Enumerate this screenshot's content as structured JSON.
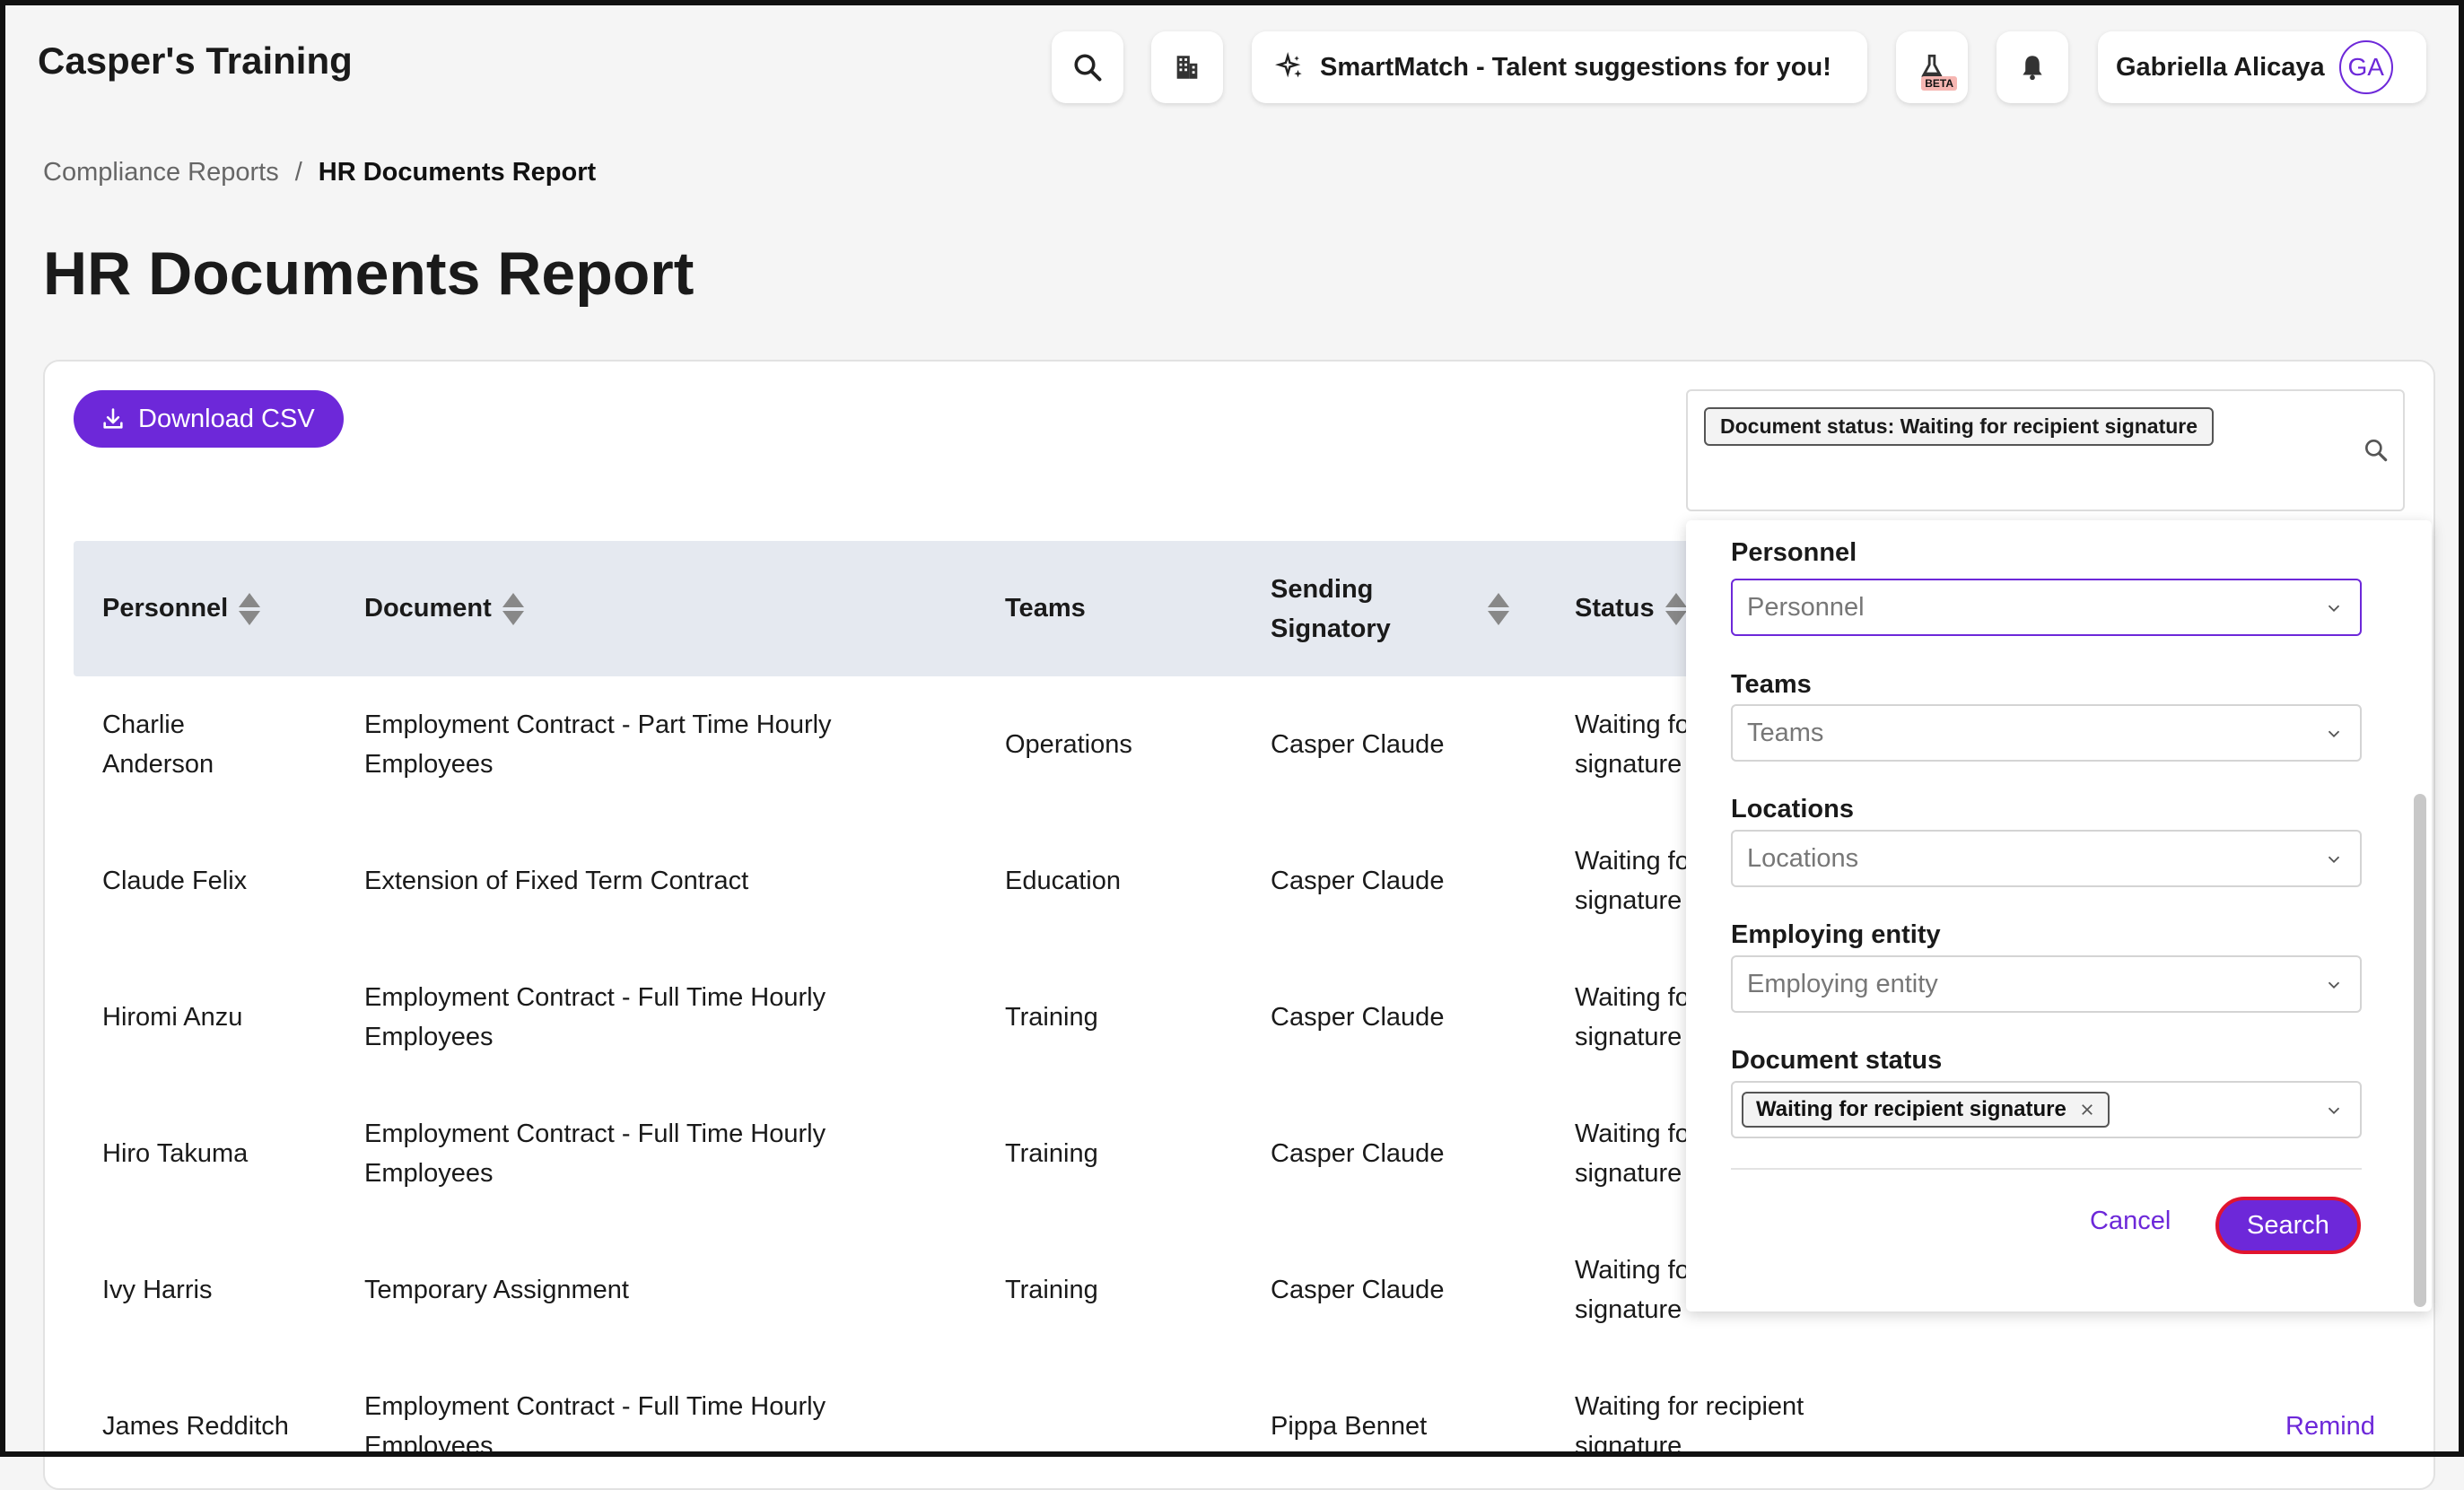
{
  "app": {
    "title": "Casper's Training"
  },
  "header": {
    "smartmatch_label": "SmartMatch - Talent suggestions for you!",
    "beta_label": "BETA",
    "user_name": "Gabriella Alicaya",
    "user_initials": "GA"
  },
  "breadcrumb": {
    "parent": "Compliance Reports",
    "separator": "/",
    "current": "HR Documents Report"
  },
  "page": {
    "title": "HR Documents Report"
  },
  "toolbar": {
    "download_label": "Download CSV"
  },
  "filter": {
    "chip_label": "Document status: Waiting for recipient signature"
  },
  "table": {
    "columns": {
      "personnel": "Personnel",
      "document": "Document",
      "teams": "Teams",
      "signatory": [
        "Sending",
        "Signatory"
      ],
      "status": "Status"
    },
    "rows": [
      {
        "personnel": [
          "Charlie",
          "Anderson"
        ],
        "document": [
          "Employment Contract - Part Time Hourly",
          "Employees"
        ],
        "teams": "Operations",
        "signatory": "Casper Claude",
        "status": [
          "Waiting for recipient",
          "signature"
        ],
        "action": ""
      },
      {
        "personnel": [
          "Claude Felix"
        ],
        "document": [
          "Extension of Fixed Term Contract"
        ],
        "teams": "Education",
        "signatory": "Casper Claude",
        "status": [
          "Waiting for recipient",
          "signature"
        ],
        "action": ""
      },
      {
        "personnel": [
          "Hiromi Anzu"
        ],
        "document": [
          "Employment Contract - Full Time Hourly",
          "Employees"
        ],
        "teams": "Training",
        "signatory": "Casper Claude",
        "status": [
          "Waiting for recipient",
          "signature"
        ],
        "action": ""
      },
      {
        "personnel": [
          "Hiro Takuma"
        ],
        "document": [
          "Employment Contract - Full Time Hourly",
          "Employees"
        ],
        "teams": "Training",
        "signatory": "Casper Claude",
        "status": [
          "Waiting for recipient",
          "signature"
        ],
        "action": ""
      },
      {
        "personnel": [
          "Ivy Harris"
        ],
        "document": [
          "Temporary Assignment"
        ],
        "teams": "Training",
        "signatory": "Casper Claude",
        "status": [
          "Waiting for recipient",
          "signature"
        ],
        "action": ""
      },
      {
        "personnel": [
          "James Redditch"
        ],
        "document": [
          "Employment Contract - Full Time Hourly",
          "Employees"
        ],
        "teams": "",
        "signatory": "Pippa Bennet",
        "status": [
          "Waiting for recipient",
          "signature"
        ],
        "action": "Remind"
      }
    ]
  },
  "panel": {
    "personnel_label": "Personnel",
    "personnel_placeholder": "Personnel",
    "teams_label": "Teams",
    "teams_placeholder": "Teams",
    "locations_label": "Locations",
    "locations_placeholder": "Locations",
    "entity_label": "Employing entity",
    "entity_placeholder": "Employing entity",
    "status_label": "Document status",
    "status_value": "Waiting for recipient signature",
    "cancel_label": "Cancel",
    "search_label": "Search"
  },
  "colors": {
    "accent": "#6d28d9",
    "focus_ring": "#e0152f",
    "table_header": "#e5e9f0"
  }
}
